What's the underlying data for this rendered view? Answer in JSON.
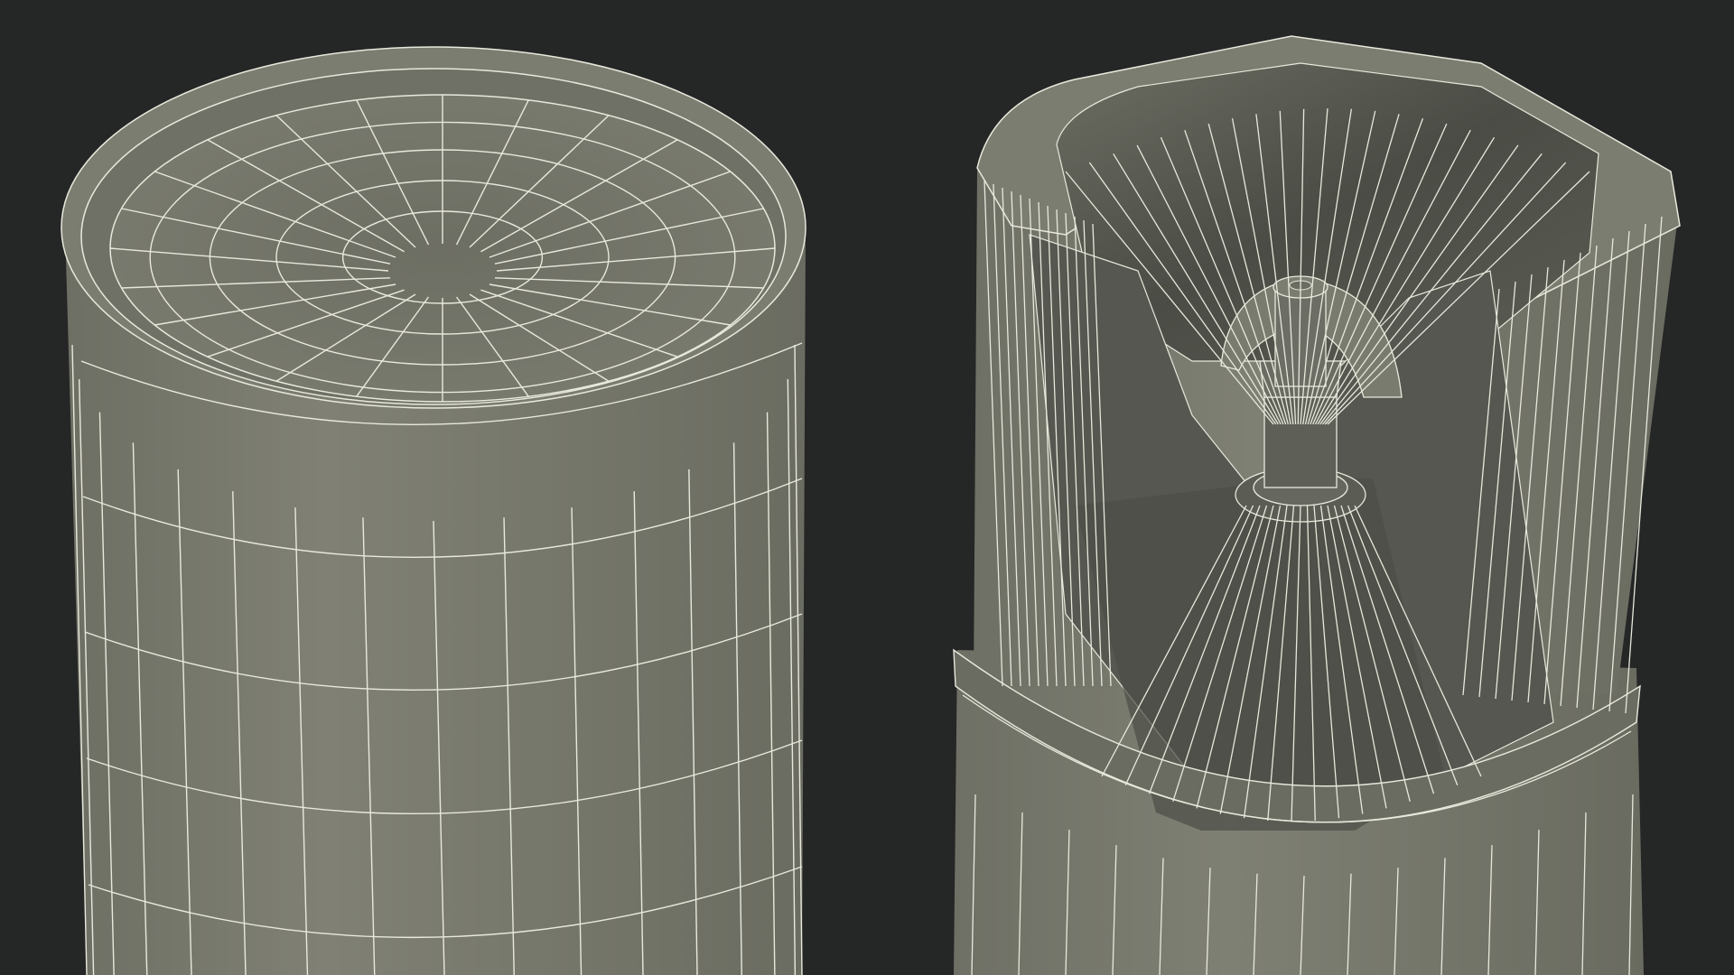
{
  "scene": {
    "background_color": "#252626",
    "mesh_fill_color": "#7a7b6f",
    "mesh_dark_color": "#4e5048",
    "mesh_shadow_color": "#3f413b",
    "wire_color": "#e8e9dc",
    "objects": [
      {
        "name": "closed-top-cylinder",
        "description_icon": "wireframe-cylinder-icon"
      },
      {
        "name": "cutaway-cylinder-with-funnel",
        "description_icon": "wireframe-funnel-icon"
      }
    ]
  }
}
